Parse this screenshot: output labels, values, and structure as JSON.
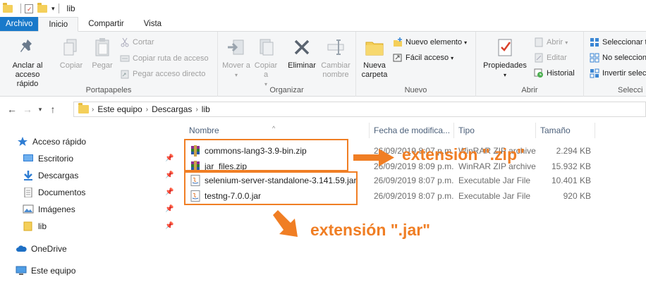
{
  "window": {
    "title": "lib"
  },
  "ribbon_tabs": [
    "Archivo",
    "Inicio",
    "Compartir",
    "Vista"
  ],
  "ribbon": {
    "portapapeles": {
      "label": "Portapapeles",
      "anclar": "Anclar al acceso rápido",
      "anclar_l1": "Anclar al",
      "anclar_l2": "acceso rápido",
      "copiar": "Copiar",
      "pegar": "Pegar",
      "cortar": "Cortar",
      "copiar_ruta": "Copiar ruta de acceso",
      "pegar_acceso": "Pegar acceso directo"
    },
    "organizar": {
      "label": "Organizar",
      "mover_a": "Mover a",
      "copiar_a": "Copiar a",
      "eliminar": "Eliminar",
      "cambiar_l1": "Cambiar",
      "cambiar_l2": "nombre"
    },
    "nuevo": {
      "label": "Nuevo",
      "nueva_l1": "Nueva",
      "nueva_l2": "carpeta",
      "nuevo_elemento": "Nuevo elemento",
      "facil_acceso": "Fácil acceso"
    },
    "abrir": {
      "label": "Abrir",
      "propiedades": "Propiedades",
      "abrir": "Abrir",
      "editar": "Editar",
      "historial": "Historial"
    },
    "seleccionar": {
      "label": "Selecci",
      "seleccionar_todo": "Seleccionar t",
      "no_seleccionar": "No seleccion",
      "invertir": "Invertir selec"
    }
  },
  "address": {
    "crumbs": [
      "Este equipo",
      "Descargas",
      "lib"
    ]
  },
  "sidebar": {
    "items": [
      {
        "label": "Acceso rápido",
        "icon": "star-icon"
      },
      {
        "label": "Escritorio",
        "icon": "desktop-icon"
      },
      {
        "label": "Descargas",
        "icon": "download-icon"
      },
      {
        "label": "Documentos",
        "icon": "documents-icon"
      },
      {
        "label": "Imágenes",
        "icon": "pictures-icon"
      },
      {
        "label": "lib",
        "icon": "folder-icon"
      },
      {
        "label": "OneDrive",
        "icon": "cloud-icon"
      },
      {
        "label": "Este equipo",
        "icon": "computer-icon"
      }
    ]
  },
  "file_list": {
    "columns": [
      "Nombre",
      "Fecha de modifica...",
      "Tipo",
      "Tamaño"
    ],
    "rows": [
      {
        "name": "commons-lang3-3.9-bin.zip",
        "date": "26/09/2019 8:07 p.m.",
        "type": "WinRAR ZIP archive",
        "size": "2.294 KB",
        "icon": "winrar-icon"
      },
      {
        "name": "jar_files.zip",
        "date": "26/09/2019 8:09 p.m.",
        "type": "WinRAR ZIP archive",
        "size": "15.932 KB",
        "icon": "winrar-icon"
      },
      {
        "name": "selenium-server-standalone-3.141.59.jar",
        "date": "26/09/2019 8:07 p.m.",
        "type": "Executable Jar File",
        "size": "10.401 KB",
        "icon": "jar-icon"
      },
      {
        "name": "testng-7.0.0.jar",
        "date": "26/09/2019 8:07 p.m.",
        "type": "Executable Jar File",
        "size": "920 KB",
        "icon": "jar-icon"
      }
    ]
  },
  "annotations": {
    "zip": "extensión \".zip\"",
    "jar": "extensión \".jar\"",
    "color": "#f07e24"
  },
  "colors": {
    "file_tab": "#1979ca",
    "accent_orange": "#f07e24"
  }
}
